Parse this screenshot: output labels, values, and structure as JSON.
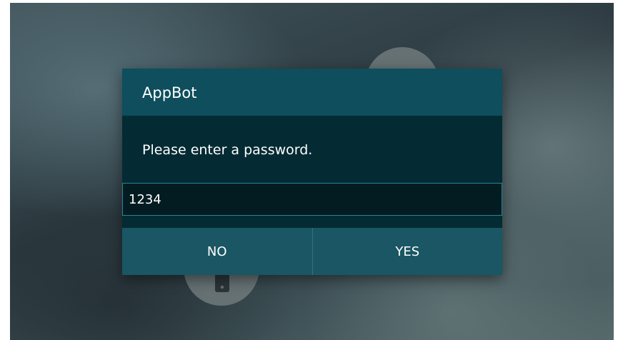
{
  "background": {
    "icons": [
      "paper-plane-icon",
      "tablet-icon"
    ]
  },
  "dialog": {
    "title": "AppBot",
    "message": "Please enter a password.",
    "input_value": "1234",
    "buttons": {
      "no": "NO",
      "yes": "YES"
    }
  },
  "colors": {
    "header": "#0e4e5d",
    "body": "#042b33",
    "buttons": "#1a5663",
    "input_border": "#2c8499"
  }
}
